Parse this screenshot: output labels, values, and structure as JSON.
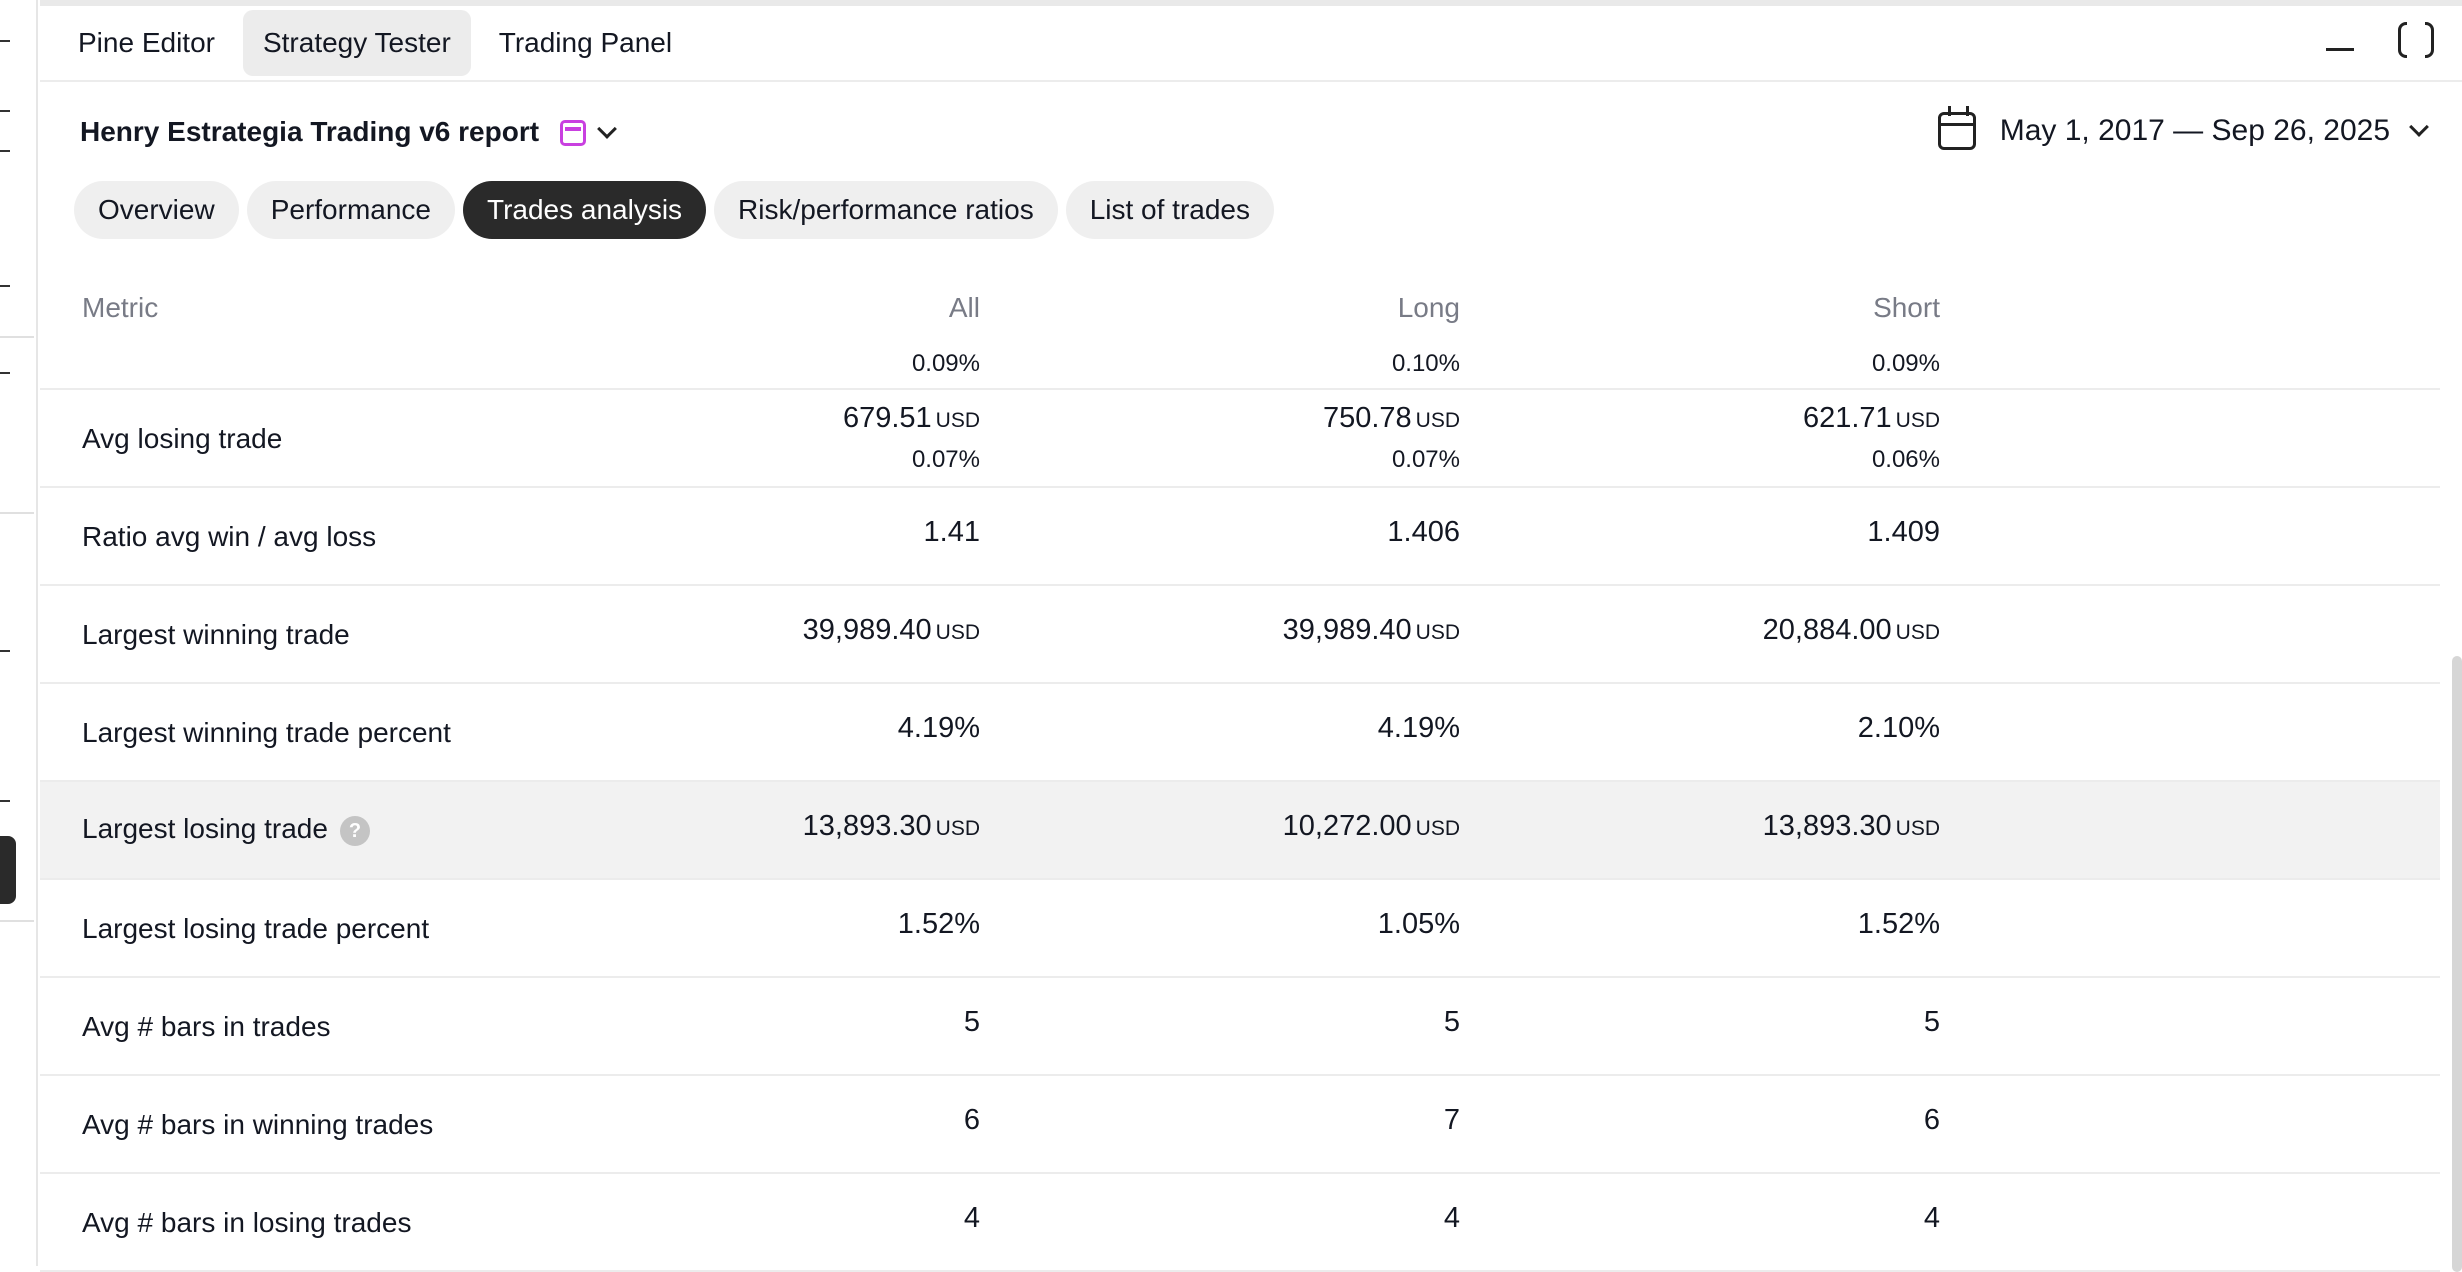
{
  "top_tabs": [
    {
      "label": "Pine Editor"
    },
    {
      "label": "Strategy Tester"
    },
    {
      "label": "Trading Panel"
    }
  ],
  "report": {
    "title": "Henry Estrategia Trading v6 report",
    "date_range": "May 1, 2017 — Sep 26, 2025"
  },
  "sub_tabs": [
    {
      "label": "Overview"
    },
    {
      "label": "Performance"
    },
    {
      "label": "Trades analysis"
    },
    {
      "label": "Risk/performance ratios"
    },
    {
      "label": "List of trades"
    }
  ],
  "table": {
    "headers": {
      "metric": "Metric",
      "all": "All",
      "long": "Long",
      "short": "Short"
    },
    "unit": "USD",
    "partial_row": {
      "all_pct": "0.09%",
      "long_pct": "0.10%",
      "short_pct": "0.09%"
    },
    "rows": [
      {
        "label": "Avg losing trade",
        "all": "679.51",
        "long": "750.78",
        "short": "621.71",
        "all_pct": "0.07%",
        "long_pct": "0.07%",
        "short_pct": "0.06%"
      },
      {
        "label": "Ratio avg win / avg loss",
        "all": "1.41",
        "long": "1.406",
        "short": "1.409"
      },
      {
        "label": "Largest winning trade",
        "all": "39,989.40",
        "long": "39,989.40",
        "short": "20,884.00"
      },
      {
        "label": "Largest winning trade percent",
        "all": "4.19%",
        "long": "4.19%",
        "short": "2.10%"
      },
      {
        "label": "Largest losing trade",
        "all": "13,893.30",
        "long": "10,272.00",
        "short": "13,893.30"
      },
      {
        "label": "Largest losing trade percent",
        "all": "1.52%",
        "long": "1.05%",
        "short": "1.52%"
      },
      {
        "label": "Avg # bars in trades",
        "all": "5",
        "long": "5",
        "short": "5"
      },
      {
        "label": "Avg # bars in winning trades",
        "all": "6",
        "long": "7",
        "short": "6"
      },
      {
        "label": "Avg # bars in losing trades",
        "all": "4",
        "long": "4",
        "short": "4"
      }
    ],
    "help_glyph": "?"
  }
}
